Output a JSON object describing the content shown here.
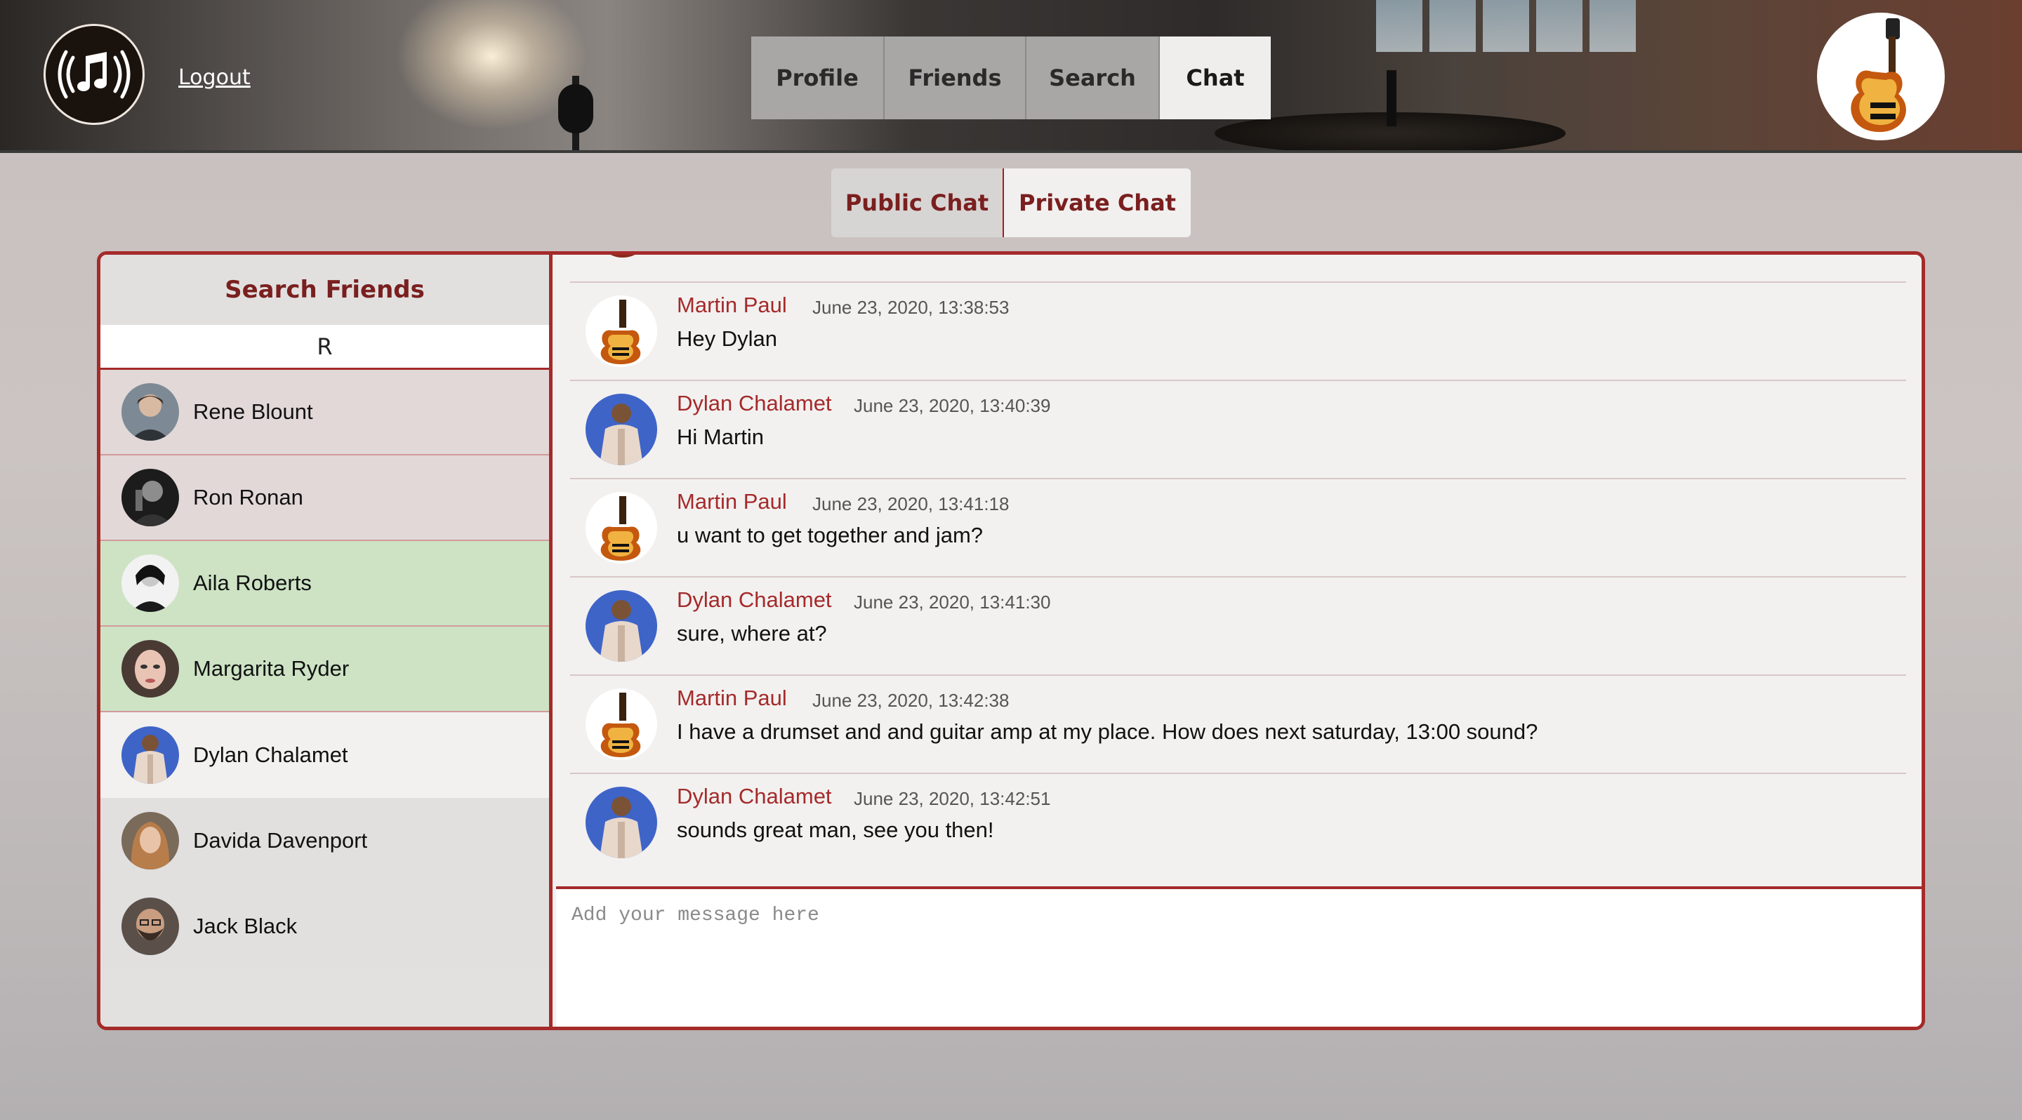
{
  "header": {
    "logout_label": "Logout",
    "nav_tabs": [
      {
        "label": "Profile",
        "active": false
      },
      {
        "label": "Friends",
        "active": false
      },
      {
        "label": "Search",
        "active": false
      },
      {
        "label": "Chat",
        "active": true
      }
    ],
    "logo_icon": "music-note-icon",
    "user_avatar_icon": "guitar-icon"
  },
  "chat_tabs": {
    "public_label": "Public Chat",
    "private_label": "Private Chat",
    "active": "Private Chat"
  },
  "friends": {
    "title": "Search Friends",
    "search_value": "R",
    "list": [
      {
        "name": "Rene Blount",
        "state": "plain"
      },
      {
        "name": "Ron Ronan",
        "state": "plain"
      },
      {
        "name": "Aila Roberts",
        "state": "green"
      },
      {
        "name": "Margarita Ryder",
        "state": "green"
      },
      {
        "name": "Dylan Chalamet",
        "state": "selected"
      },
      {
        "name": "Davida Davenport",
        "state": "none"
      },
      {
        "name": "Jack Black",
        "state": "none"
      }
    ]
  },
  "messages": [
    {
      "author": "Martin Paul",
      "time": "June 23, 2020, 13:38:53",
      "text": "Hey Dylan",
      "avatar": "guitar-icon"
    },
    {
      "author": "Dylan Chalamet",
      "time": "June 23, 2020, 13:40:39",
      "text": "Hi Martin",
      "avatar": "person-icon"
    },
    {
      "author": "Martin Paul",
      "time": "June 23, 2020, 13:41:18",
      "text": "u want to get together and jam?",
      "avatar": "guitar-icon"
    },
    {
      "author": "Dylan Chalamet",
      "time": "June 23, 2020, 13:41:30",
      "text": "sure, where at?",
      "avatar": "person-icon"
    },
    {
      "author": "Martin Paul",
      "time": "June 23, 2020, 13:42:38",
      "text": "I have a drumset and and guitar amp at my place. How does next saturday, 13:00 sound?",
      "avatar": "guitar-icon"
    },
    {
      "author": "Dylan Chalamet",
      "time": "June 23, 2020, 13:42:51",
      "text": "sounds great man, see you then!",
      "avatar": "person-icon"
    }
  ],
  "composer": {
    "placeholder": "Add your message here"
  },
  "colors": {
    "accent": "#a52a2a",
    "title_red": "#7a1f1f",
    "highlight_green": "#cde3c4"
  }
}
